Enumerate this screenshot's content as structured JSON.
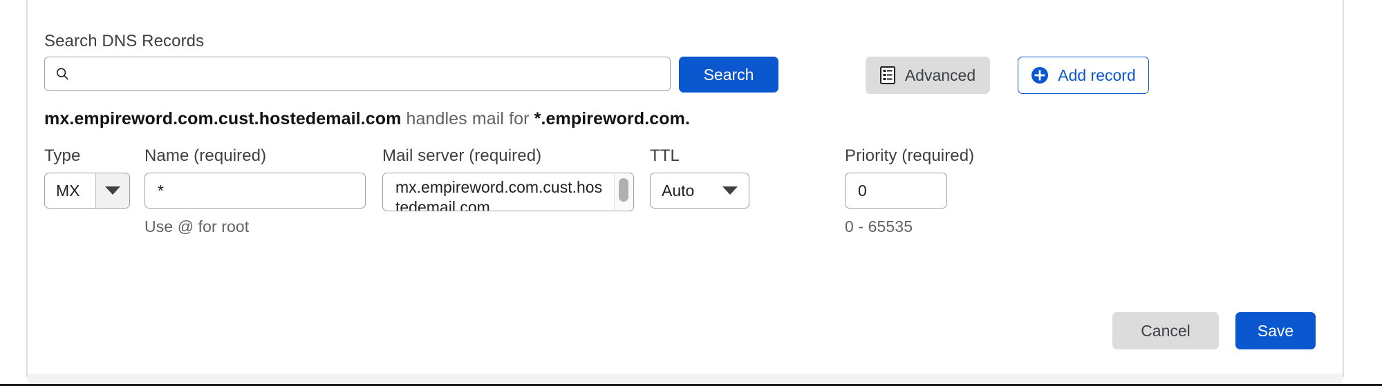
{
  "search": {
    "label": "Search DNS Records",
    "value": "",
    "placeholder": "",
    "icon": "search-icon",
    "search_button": "Search",
    "advanced_button": "Advanced",
    "advanced_icon": "list-document-icon",
    "add_record_button": "Add record",
    "add_record_icon": "plus-circle-icon"
  },
  "description": {
    "server": "mx.empireword.com.cust.hostedemail.com",
    "middle": " handles mail for ",
    "domain": "*.empireword.com",
    "period": "."
  },
  "form": {
    "type": {
      "label": "Type",
      "value": "MX",
      "caret_icon": "chevron-down-icon"
    },
    "name": {
      "label": "Name (required)",
      "value": "*",
      "hint": "Use @ for root"
    },
    "mail_server": {
      "label": "Mail server (required)",
      "value": "mx.empireword.com.cust.hostedemail.com"
    },
    "ttl": {
      "label": "TTL",
      "value": "Auto",
      "caret_icon": "chevron-down-icon"
    },
    "priority": {
      "label": "Priority (required)",
      "value": "0",
      "hint": "0 - 65535"
    }
  },
  "footer": {
    "cancel_label": "Cancel",
    "save_label": "Save"
  },
  "colors": {
    "accent_blue": "#0b57cf",
    "button_gray": "#dcdcdc",
    "border_gray": "#9aa0a6",
    "text_primary": "#202124",
    "text_secondary": "#5f6368"
  }
}
